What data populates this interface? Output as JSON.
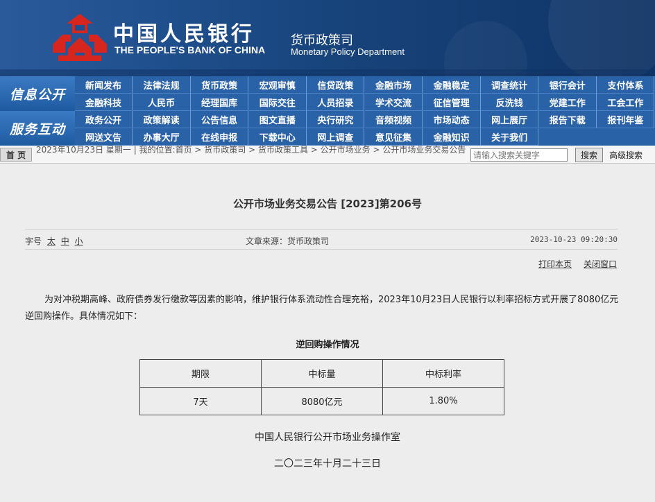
{
  "header": {
    "bank_name_cn": "中国人民银行",
    "bank_name_en": "THE PEOPLE'S BANK OF CHINA",
    "dept_cn": "货币政策司",
    "dept_en": "Monetary Policy Department"
  },
  "nav": {
    "section1": "信息公开",
    "section2": "服务互动",
    "row1": [
      "新闻发布",
      "法律法规",
      "货币政策",
      "宏观审慎",
      "信贷政策",
      "金融市场",
      "金融稳定",
      "调查统计",
      "银行会计",
      "支付体系",
      "金融科技",
      "人民币",
      "经理国库",
      "国际交往",
      "人员招录",
      "学术交流",
      "征信管理",
      "反洗钱",
      "党建工作",
      "工会工作"
    ],
    "row2": [
      "政务公开",
      "政策解读",
      "公告信息",
      "图文直播",
      "央行研究",
      "音频视频",
      "市场动态",
      "网上展厅",
      "报告下载",
      "报刊年鉴",
      "网送文告",
      "办事大厅",
      "在线申报",
      "下载中心",
      "网上调查",
      "意见征集",
      "金融知识",
      "关于我们"
    ]
  },
  "crumb": {
    "home": "首 页",
    "text": "2023年10月23日 星期一 | 我的位置:首页 > 货币政策司 > 货币政策工具 > 公开市场业务 > 公开市场业务交易公告",
    "search_placeholder": "请输入搜索关键字",
    "search_button": "搜索",
    "advanced": "高级搜索"
  },
  "article": {
    "title": "公开市场业务交易公告 [2023]第206号",
    "font_label": "字号",
    "font_sizes": [
      "太",
      "中",
      "小"
    ],
    "source": "文章来源：货币政策司",
    "datetime": "2023-10-23 09:20:30",
    "print": "打印本页",
    "close": "关闭窗口",
    "paragraph": "为对冲税期高峰、政府债券发行缴款等因素的影响，维护银行体系流动性合理充裕，2023年10月23日人民银行以利率招标方式开展了8080亿元逆回购操作。具体情况如下：",
    "table_title": "逆回购操作情况",
    "table": {
      "headers": [
        "期限",
        "中标量",
        "中标利率"
      ],
      "rows": [
        [
          "7天",
          "8080亿元",
          "1.80%"
        ]
      ]
    },
    "signature": "中国人民银行公开市场业务操作室",
    "date_cn": "二〇二三年十月二十三日"
  },
  "colors": {
    "header_bg": "#1f4f8c",
    "nav_bg": "#2a62a8",
    "logo_red": "#d7261e",
    "page_bg": "#ededed"
  }
}
